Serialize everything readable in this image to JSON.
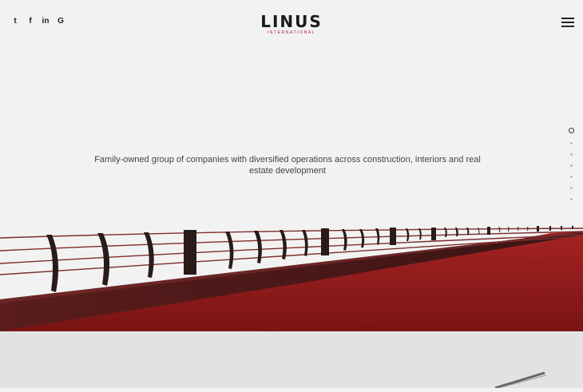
{
  "header": {
    "social": [
      {
        "icon": "twitter-icon",
        "glyph": "t"
      },
      {
        "icon": "facebook-icon",
        "glyph": "f"
      },
      {
        "icon": "linkedin-icon",
        "glyph": "in"
      },
      {
        "icon": "google-icon",
        "glyph": "G"
      }
    ],
    "logo": {
      "word_left": "LI",
      "word_accent": "N",
      "word_right": "US",
      "subtitle": "INTERNATIONAL"
    }
  },
  "hero": {
    "tagline": "Family-owned group of companies with diversified operations across construction, interiors and real estate development"
  },
  "section_nav": {
    "count": 7,
    "active_index": 0
  },
  "colors": {
    "accent": "#b01e2a",
    "background": "#f2f2f2",
    "floor": "#8e1b1c"
  }
}
